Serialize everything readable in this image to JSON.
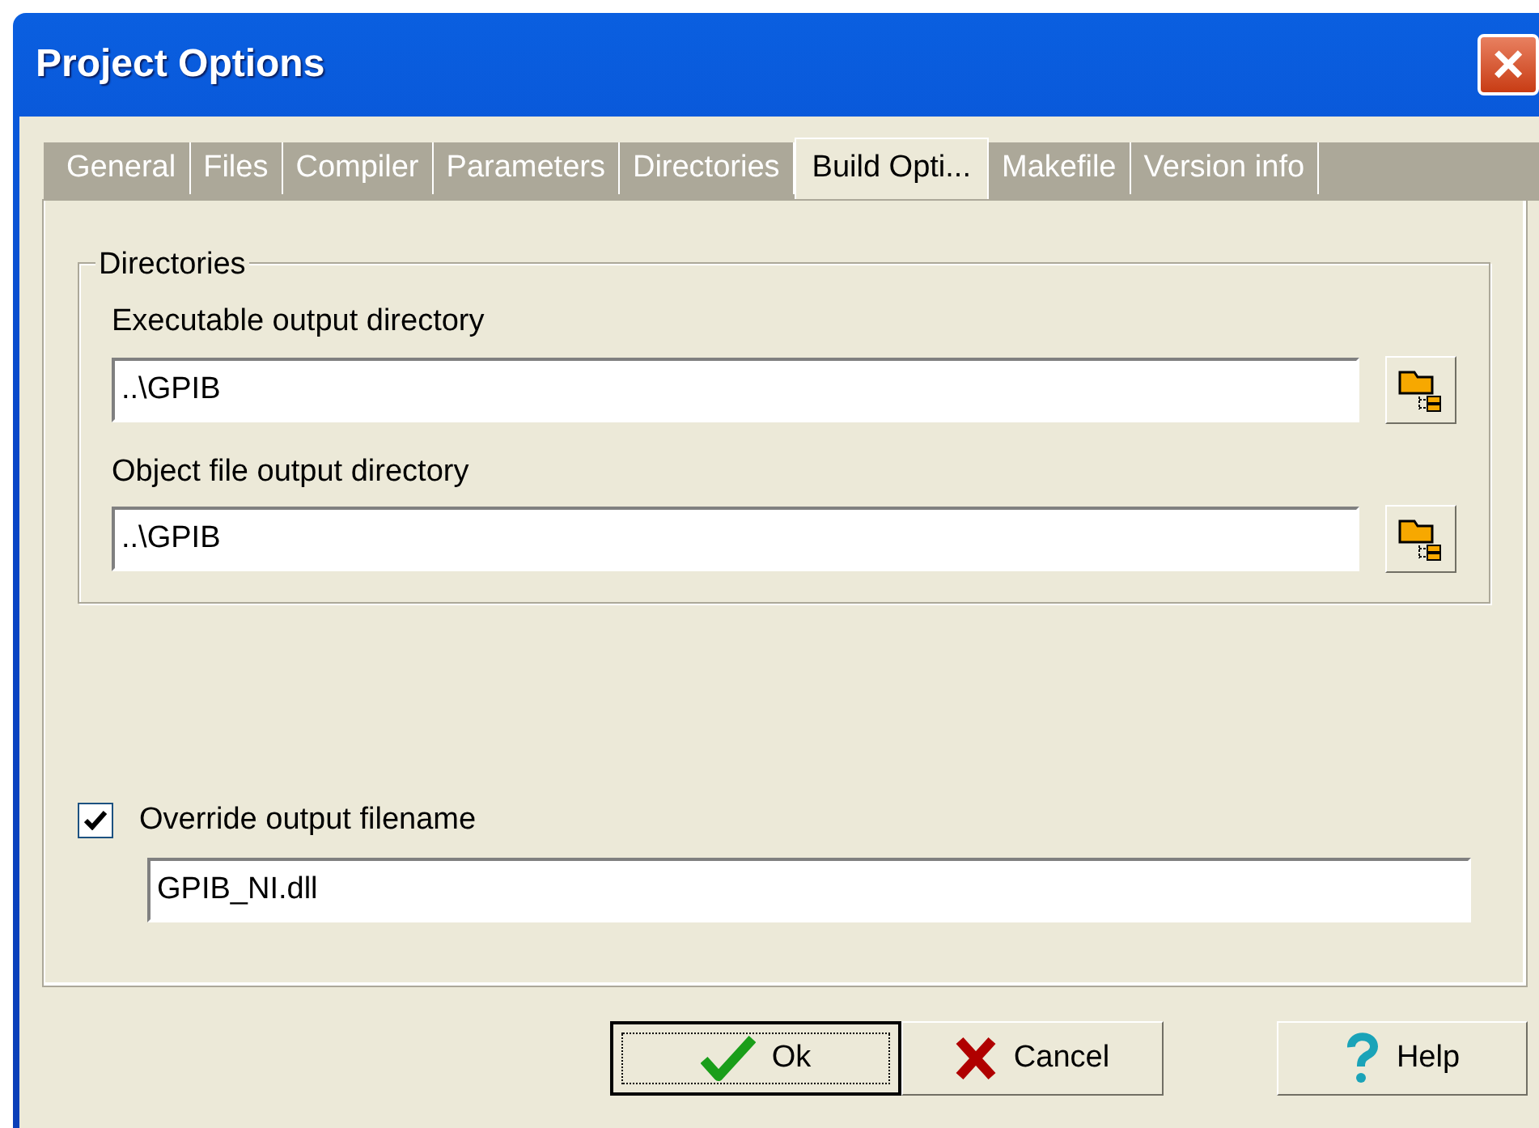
{
  "window": {
    "title": "Project Options",
    "close": "×"
  },
  "tabs": [
    {
      "label": "General",
      "selected": false
    },
    {
      "label": "Files",
      "selected": false
    },
    {
      "label": "Compiler",
      "selected": false
    },
    {
      "label": "Parameters",
      "selected": false
    },
    {
      "label": "Directories",
      "selected": false
    },
    {
      "label": "Build Opti...",
      "selected": true
    },
    {
      "label": "Makefile",
      "selected": false
    },
    {
      "label": "Version info",
      "selected": false
    }
  ],
  "group": {
    "title": "Directories",
    "fields": [
      {
        "label": "Executable output directory",
        "value": "..\\GPIB"
      },
      {
        "label": "Object file output directory",
        "value": "..\\GPIB"
      }
    ]
  },
  "override": {
    "label": "Override output filename",
    "checked": true,
    "value": "GPIB_NI.dll"
  },
  "buttons": [
    {
      "kind": "ok",
      "label": "Ok",
      "focused": true
    },
    {
      "kind": "cancel",
      "label": "Cancel",
      "focused": false
    },
    {
      "kind": "help",
      "label": "Help",
      "focused": false
    }
  ]
}
